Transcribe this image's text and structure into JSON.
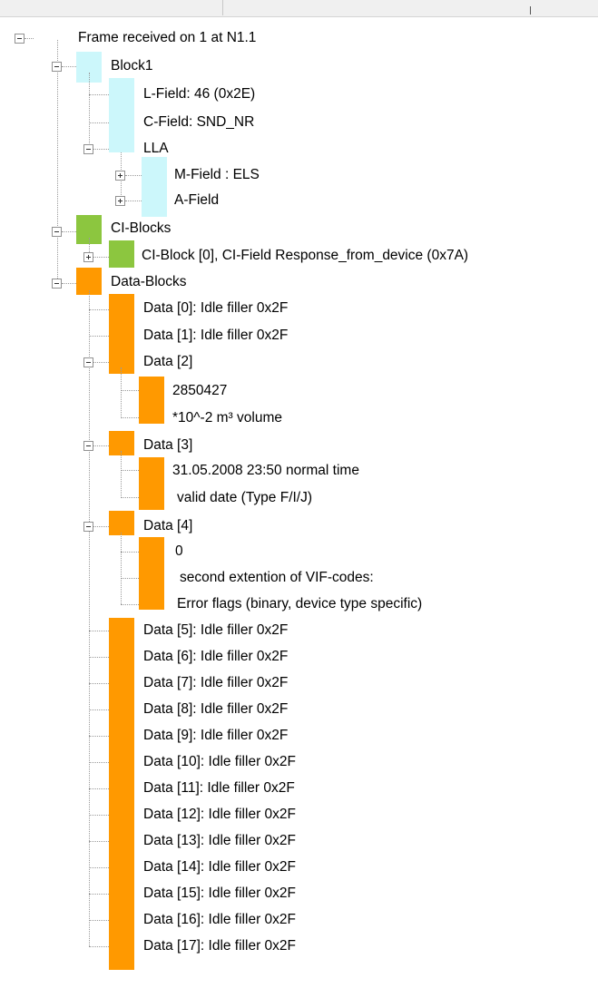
{
  "colors": {
    "block": "#ccf7fb",
    "ci": "#8cc63f",
    "data": "#ff9900",
    "tree_line": "#9a9a9a"
  },
  "tree": {
    "frame": "Frame received on 1 at N1.1",
    "block1": "Block1",
    "lfield": "L-Field: 46 (0x2E)",
    "cfield": "C-Field: SND_NR",
    "lla": "LLA",
    "mfield": "M-Field : ELS",
    "afield": "A-Field",
    "ciblocks": "CI-Blocks",
    "ciblock0": "CI-Block [0], CI-Field Response_from_device (0x7A)",
    "datablocks": "Data-Blocks",
    "data0": "Data [0]: Idle filler 0x2F",
    "data1": "Data [1]: Idle filler 0x2F",
    "data2": "Data [2]",
    "data2_value": "2850427",
    "data2_unit": "*10^-2 m³ volume",
    "data3": "Data [3]",
    "data3_value": "31.05.2008 23:50 normal time",
    "data3_desc": "valid date (Type F/I/J)",
    "data4": "Data [4]",
    "data4_value": "0",
    "data4_ext": "second extention of VIF-codes:",
    "data4_err": "Error flags (binary, device type specific)",
    "data5": "Data [5]: Idle filler 0x2F",
    "data6": "Data [6]: Idle filler 0x2F",
    "data7": "Data [7]: Idle filler 0x2F",
    "data8": "Data [8]: Idle filler 0x2F",
    "data9": "Data [9]: Idle filler 0x2F",
    "data10": "Data [10]: Idle filler 0x2F",
    "data11": "Data [11]: Idle filler 0x2F",
    "data12": "Data [12]: Idle filler 0x2F",
    "data13": "Data [13]: Idle filler 0x2F",
    "data14": "Data [14]: Idle filler 0x2F",
    "data15": "Data [15]: Idle filler 0x2F",
    "data16": "Data [16]: Idle filler 0x2F",
    "data17": "Data [17]: Idle filler 0x2F"
  }
}
